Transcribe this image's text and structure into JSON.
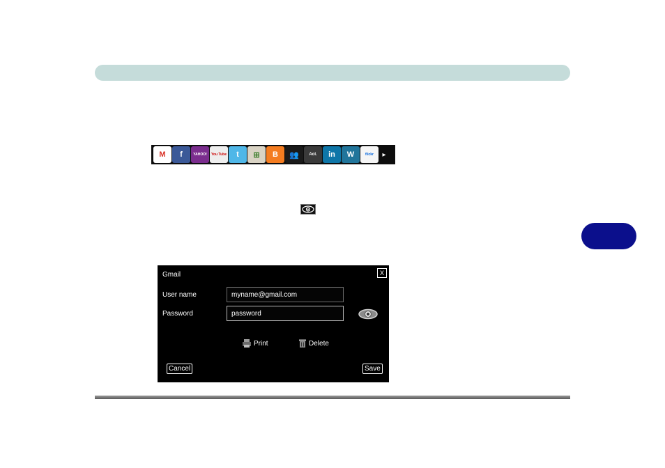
{
  "colors": {
    "header_bar": "#c5dcda",
    "chapter_tab": "#0b0f8c",
    "dialog_bg": "#000000"
  },
  "toolbar": {
    "icons": [
      {
        "name": "gmail-icon",
        "label": "M",
        "color": "#ffffff",
        "text_color": "#d93025"
      },
      {
        "name": "facebook-icon",
        "label": "f",
        "color": "#3b5998",
        "text_color": "#ffffff"
      },
      {
        "name": "yahoo-icon",
        "label": "YAHOO!",
        "color": "#7b2d8e",
        "text_color": "#ffffff"
      },
      {
        "name": "youtube-icon",
        "label": "You Tube",
        "color": "#eeeeee",
        "text_color": "#cc0000"
      },
      {
        "name": "twitter-icon",
        "label": "t",
        "color": "#4fb7e8",
        "text_color": "#ffffff"
      },
      {
        "name": "windows-live-icon",
        "label": "⊞",
        "color": "#d9d3c4",
        "text_color": "#3a7d2a"
      },
      {
        "name": "blogger-icon",
        "label": "B",
        "color": "#f47c20",
        "text_color": "#ffffff"
      },
      {
        "name": "myspace-icon",
        "label": "👥",
        "color": "#1a1a1a",
        "text_color": "#ffffff"
      },
      {
        "name": "aol-icon",
        "label": "Aol.",
        "color": "#3a3a3a",
        "text_color": "#ffffff"
      },
      {
        "name": "linkedin-icon",
        "label": "in",
        "color": "#0e76a8",
        "text_color": "#ffffff"
      },
      {
        "name": "wordpress-icon",
        "label": "W",
        "color": "#21759b",
        "text_color": "#ffffff"
      },
      {
        "name": "flickr-icon",
        "label": "flickr",
        "color": "#f5f5f5",
        "text_color": "#0063dc"
      }
    ]
  },
  "dialog": {
    "title": "Gmail",
    "close_label": "X",
    "username_label": "User name",
    "username_value": "myname@gmail.com",
    "password_label": "Password",
    "password_value": "password",
    "print_label": "Print",
    "delete_label": "Delete",
    "cancel_label": "Cancel",
    "save_label": "Save"
  }
}
